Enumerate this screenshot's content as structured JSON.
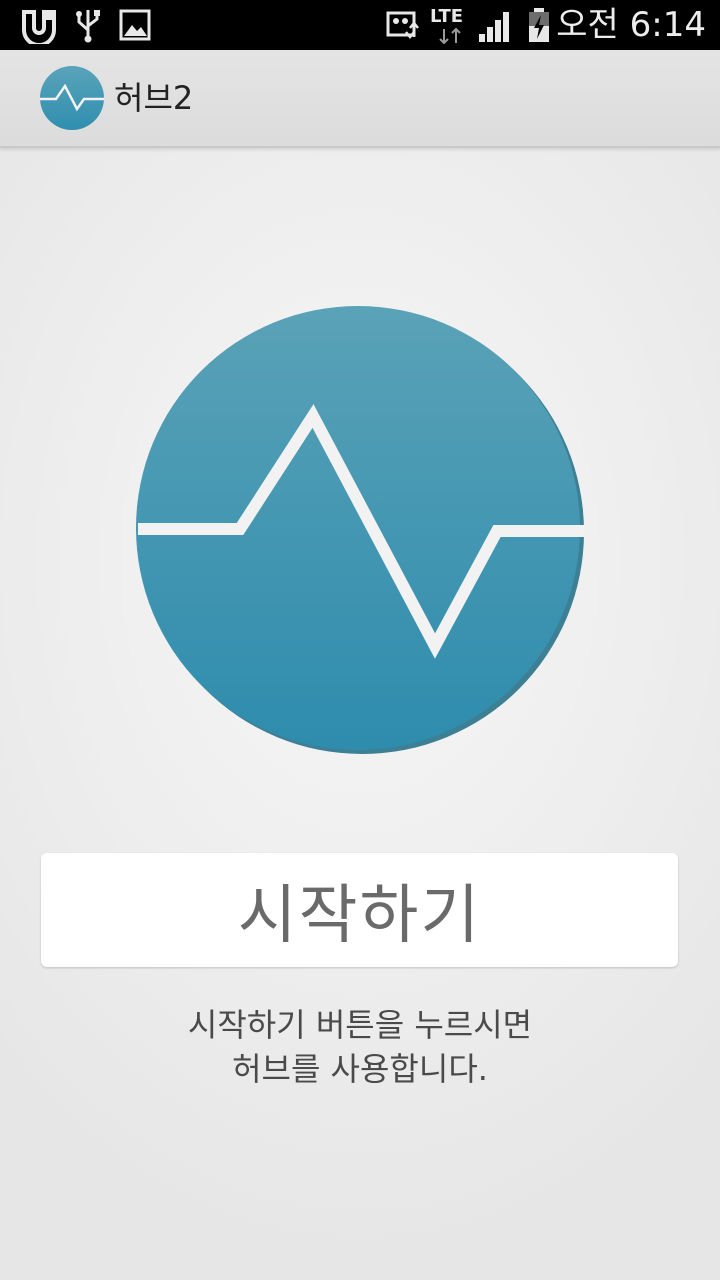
{
  "status_bar": {
    "time": "오전 6:14",
    "network_label": "LTE",
    "icons": [
      "u-plus-icon",
      "usb-icon",
      "image-icon",
      "data-icon",
      "lte-icon",
      "signal-icon",
      "battery-charging-icon"
    ]
  },
  "action_bar": {
    "title": "허브2",
    "icon": "pulse-logo-icon"
  },
  "main": {
    "start_button_label": "시작하기",
    "hint_line1": "시작하기 버튼을 누르시면",
    "hint_line2": "허브를 사용합니다."
  },
  "colors": {
    "brand_teal": "#3f97b3",
    "brand_teal_dark": "#3a7f96",
    "status_bar_bg": "#000000",
    "action_bar_bg": "#e0e0e0",
    "button_text": "#6a6a6a"
  }
}
